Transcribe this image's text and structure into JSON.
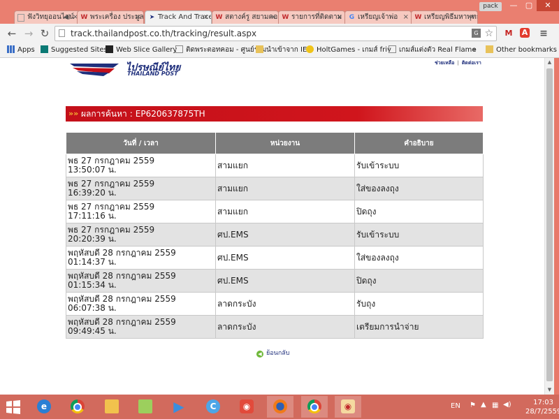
{
  "browser": {
    "tabs": [
      {
        "label": "ฟังวิทยุออนไลน์",
        "active": false
      },
      {
        "label": "พระเครื่อง ประมูล",
        "active": false
      },
      {
        "label": "Track And Trace",
        "active": true
      },
      {
        "label": "สตางค์รู สยามคอม",
        "active": false
      },
      {
        "label": "รายการที่ติดตาม",
        "active": false
      },
      {
        "label": "เหรียญเจ้าพ่อ",
        "active": false
      },
      {
        "label": "เหรียญพิธีมหาพุทธาภิเษก",
        "active": false
      }
    ],
    "profile_badge": "pack",
    "url": "track.thailandpost.co.th/tracking/result.aspx",
    "bookmarks": [
      "Apps",
      "Suggested Sites",
      "Web Slice Gallery",
      "ติดพระตอทคอม - ศูนย์รวม",
      "นำเข้าจาก IE",
      "HoltGames - เกมส์ friv",
      "เกมส์แต่งตัว Real Flame",
      "»",
      "Other bookmarks"
    ]
  },
  "site": {
    "logo_th": "ไปรษณีย์ไทย",
    "logo_en": "THAILAND POST",
    "link_help": "ช่วยเหลือ",
    "link_contact": "ติดต่อเรา",
    "result_arrows": "»»",
    "result_label": "ผลการค้นหา",
    "result_separator": ":",
    "tracking_number": "EP620637875TH",
    "table": {
      "headers": [
        "วันที่ / เวลา",
        "หน่วยงาน",
        "คำอธิบาย"
      ],
      "rows": [
        {
          "day": "พธ 27 กรกฎาคม 2559",
          "time": "13:50:07 น.",
          "office": "สามแยก",
          "description": "รับเข้าระบบ"
        },
        {
          "day": "พธ 27 กรกฎาคม 2559",
          "time": "16:39:20 น.",
          "office": "สามแยก",
          "description": "ใส่ของลงถุง"
        },
        {
          "day": "พธ 27 กรกฎาคม 2559",
          "time": "17:11:16 น.",
          "office": "สามแยก",
          "description": "ปิดถุง"
        },
        {
          "day": "พธ 27 กรกฎาคม 2559",
          "time": "20:20:39 น.",
          "office": "ศป.EMS",
          "description": "รับเข้าระบบ"
        },
        {
          "day": "พฤหัสบดี 28 กรกฎาคม 2559",
          "time": "01:14:37 น.",
          "office": "ศป.EMS",
          "description": "ใส่ของลงถุง"
        },
        {
          "day": "พฤหัสบดี 28 กรกฎาคม 2559",
          "time": "01:15:34 น.",
          "office": "ศป.EMS",
          "description": "ปิดถุง"
        },
        {
          "day": "พฤหัสบดี 28 กรกฎาคม 2559",
          "time": "06:07:38 น.",
          "office": "ลาดกระบัง",
          "description": "รับถุง"
        },
        {
          "day": "พฤหัสบดี 28 กรกฎาคม 2559",
          "time": "09:49:45 น.",
          "office": "ลาดกระบัง",
          "description": "เตรียมการนำจ่าย"
        }
      ]
    },
    "back_label": "ย้อนกลับ"
  },
  "taskbar": {
    "language": "EN",
    "time": "17:03",
    "date": "28/7/2559"
  },
  "colors": {
    "window_frame": "#e8796a",
    "result_header_red": "#c4101a",
    "table_header_gray": "#7c7c7c",
    "row_alt_gray": "#e3e3e3",
    "brand_navy": "#1f2f7c"
  },
  "icons": {
    "tab_favicons": [
      "speaker-icon",
      "w-logo-icon",
      "thailandpost-icon",
      "w-logo-icon",
      "w-logo-icon",
      "google-icon",
      "w-logo-icon"
    ],
    "toolbar": [
      "back-arrow-icon",
      "forward-arrow-icon",
      "reload-icon",
      "page-icon",
      "translate-icon",
      "star-icon",
      "gmail-icon",
      "adobe-icon",
      "menu-icon"
    ],
    "taskbar": [
      "windows-start-icon",
      "internet-explorer-icon",
      "chrome-icon",
      "file-explorer-icon",
      "stickies-icon",
      "media-player-icon",
      "cc-icon",
      "app-icon",
      "firefox-icon",
      "chrome-icon",
      "eye-app-icon"
    ]
  }
}
